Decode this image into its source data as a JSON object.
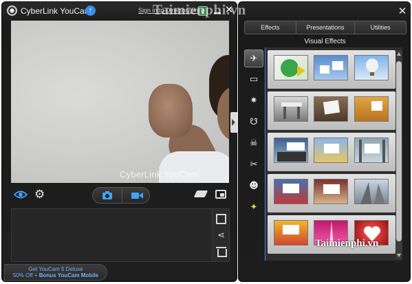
{
  "left_window": {
    "title": "CyberLink YouCam",
    "signin_link": "Sign in to DirectorZone",
    "preview_watermark": "CyberLink YouCam",
    "promo": {
      "line1": "Get YouCam 5 Deluxe",
      "line2_prefix": "50% Off + ",
      "line2_bold": "Bonus YouCam Mobile"
    }
  },
  "right_window": {
    "tabs": [
      "Effects",
      "Presentations",
      "Utilities"
    ],
    "section_title": "Visual Effects",
    "categories": [
      "particle-effect-icon",
      "frame-icon",
      "magic-wand-icon",
      "mask-icon",
      "avatar-icon",
      "distortion-icon",
      "emotion-icon",
      "star-icon"
    ],
    "active_category": 0
  },
  "overlay_watermark": {
    "top": "Taimienphi.vn",
    "bottom": "Taimienphi.vn"
  },
  "colors": {
    "window_bg": "#1e1e1e",
    "accent_blue": "#3f8ce0",
    "promo_text": "#6fb3ff"
  }
}
